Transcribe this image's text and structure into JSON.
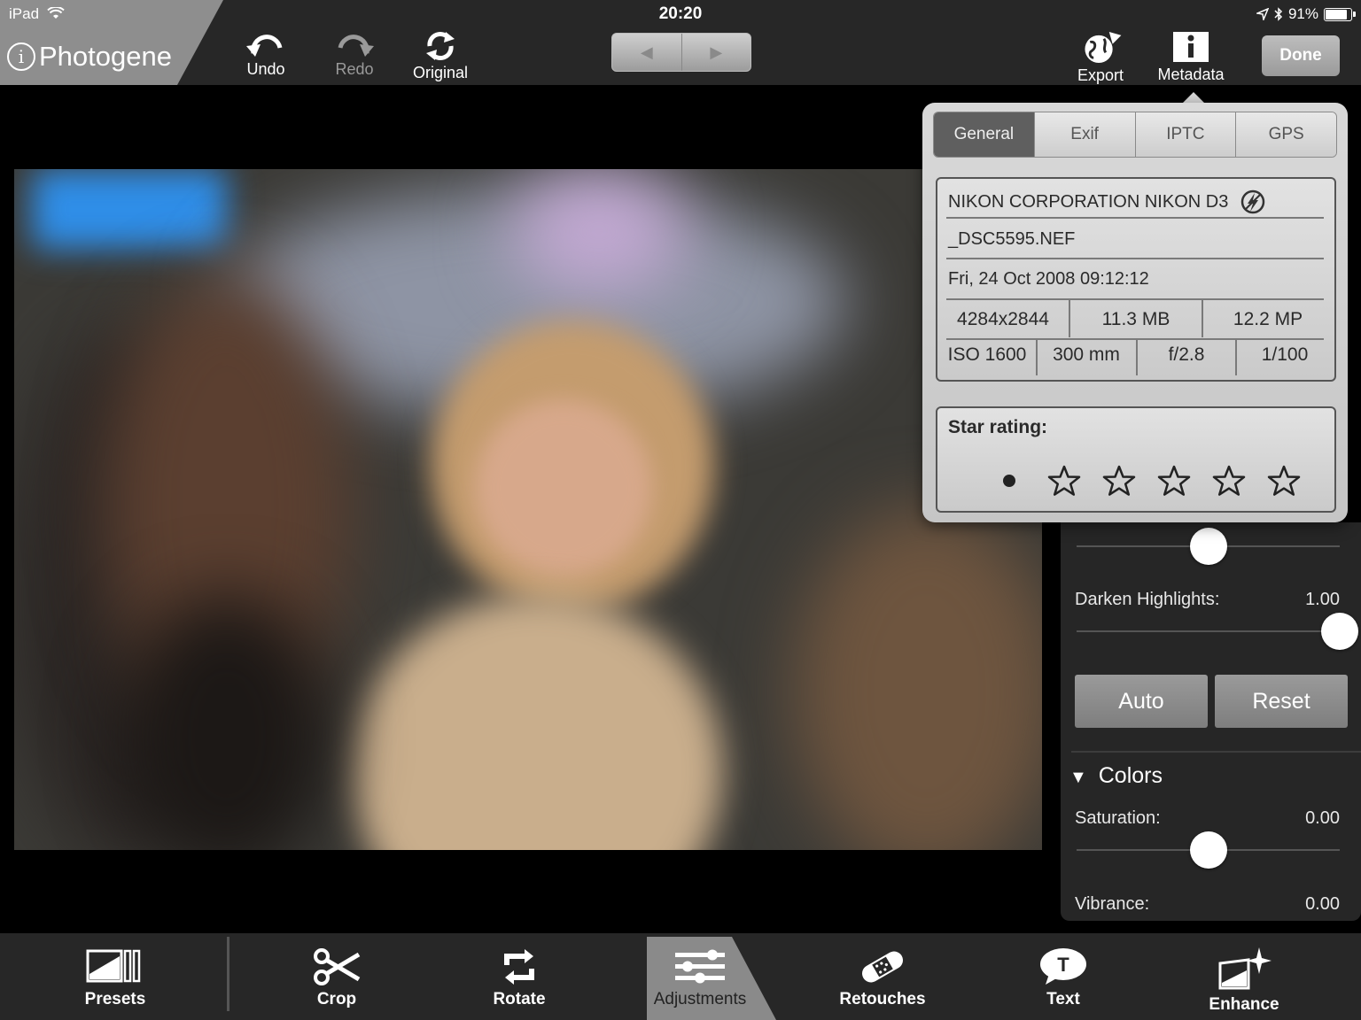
{
  "status_bar": {
    "carrier": "iPad",
    "time": "20:20",
    "battery": "91%",
    "battery_level": 0.91
  },
  "app": {
    "title": "Photogene"
  },
  "toolbar": {
    "undo": "Undo",
    "redo": "Redo",
    "original": "Original",
    "export": "Export",
    "metadata": "Metadata",
    "done": "Done"
  },
  "metadata_popover": {
    "tabs": [
      "General",
      "Exif",
      "IPTC",
      "GPS"
    ],
    "active_tab": "General",
    "camera": "NIKON CORPORATION NIKON D3",
    "filename": "_DSC5595.NEF",
    "date": "Fri, 24 Oct 2008 09:12:12",
    "dimensions": "4284x2844",
    "file_size": "11.3 MB",
    "megapixels": "12.2 MP",
    "iso": "ISO 1600",
    "focal_length": "300 mm",
    "aperture": "f/2.8",
    "shutter": "1/100",
    "star_rating_label": "Star rating:",
    "star_rating": 0
  },
  "adjustments": {
    "slider_top_value": 0.5,
    "darken_highlights": {
      "label": "Darken Highlights:",
      "value": "1.00",
      "level": 1.0
    },
    "auto": "Auto",
    "reset": "Reset",
    "colors_section": "Colors",
    "saturation": {
      "label": "Saturation:",
      "value": "0.00",
      "level": 0.5
    },
    "vibrance": {
      "label": "Vibrance:",
      "value": "0.00"
    }
  },
  "bottom_tools": [
    "Presets",
    "Crop",
    "Rotate",
    "Adjustments",
    "Retouches",
    "Text",
    "Enhance"
  ],
  "active_bottom_tool": "Adjustments"
}
